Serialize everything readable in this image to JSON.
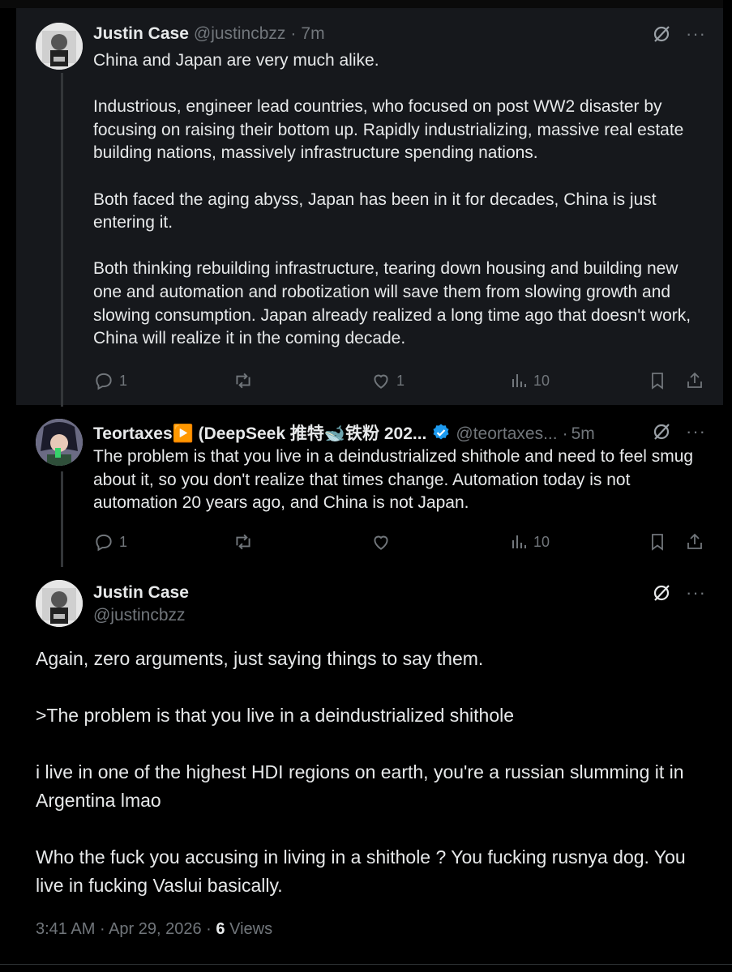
{
  "tweet1": {
    "name": "Justin Case",
    "handle": "@justincbzz",
    "separator": "·",
    "time": "7m",
    "paragraphs": [
      "China and Japan are very much alike.",
      "Industrious, engineer lead countries, who focused on post WW2 disaster by focusing on raising their bottom up. Rapidly industrializing, massive real estate building nations, massively infrastructure spending nations.",
      "Both faced the aging abyss, Japan has been in it for decades, China is just entering it.",
      "Both thinking rebuilding infrastructure, tearing down housing and building new one and automation and robotization will save them from slowing growth and slowing consumption. Japan already realized a long time ago that doesn't work, China will realize it in the coming decade."
    ],
    "replies": "1",
    "reposts": "",
    "likes": "1",
    "views": "10"
  },
  "tweet2": {
    "name": "Teortaxes▶️ (DeepSeek 推特🐋铁粉 202...",
    "handle": "@teortaxes...",
    "separator": "·",
    "time": "5m",
    "paragraphs": [
      "The problem is that you live in a deindustrialized shithole and need to feel smug about it, so you don't realize that times change. Automation today is not automation 20 years ago, and China is not Japan."
    ],
    "replies": "1",
    "reposts": "",
    "likes": "",
    "views": "10"
  },
  "tweet3": {
    "name": "Justin Case",
    "handle": "@justincbzz",
    "paragraphs": [
      "Again, zero arguments, just saying things to say them.",
      ">The problem is that you live in a deindustrialized shithole",
      "i live in one of the highest HDI regions on earth, you're a russian slumming it in Argentina lmao",
      "Who the fuck you accusing in living in a shithole ? You fucking rusnya dog. You live in fucking Vaslui basically."
    ],
    "time": "3:41 AM",
    "separator": "·",
    "date": "Apr 29, 2026",
    "separator2": "·",
    "views_count": "6",
    "views_label": "Views"
  },
  "icons": [
    "grok-icon",
    "more-icon",
    "reply-icon",
    "repost-icon",
    "like-icon",
    "views-icon",
    "bookmark-icon",
    "share-icon",
    "verified-badge-icon"
  ],
  "colors": {
    "background": "#000000",
    "highlight": "#16181c",
    "text": "#e7e9ea",
    "muted": "#71767b",
    "verified": "#1d9bf0"
  }
}
